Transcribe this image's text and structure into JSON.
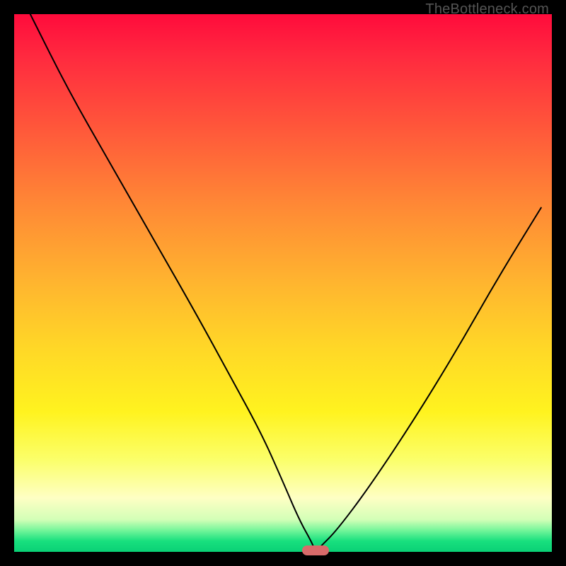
{
  "watermark": "TheBottleneck.com",
  "colors": {
    "gradient_top": "#ff0b3c",
    "gradient_mid1": "#ff8a35",
    "gradient_mid2": "#fff31f",
    "gradient_pale": "#feffc4",
    "gradient_bottom": "#0ad176",
    "curve": "#000000",
    "marker": "#d86a6a",
    "frame": "#000000"
  },
  "chart_data": {
    "type": "line",
    "title": "",
    "xlabel": "",
    "ylabel": "",
    "xlim": [
      0,
      100
    ],
    "ylim": [
      0,
      100
    ],
    "grid": false,
    "legend": false,
    "marker": {
      "x": 56,
      "y": 0,
      "width_pct": 5
    },
    "series": [
      {
        "name": "bottleneck-curve",
        "x": [
          3,
          10,
          18,
          26,
          34,
          40,
          46,
          50,
          53,
          55.5,
          56,
          57,
          60,
          66,
          74,
          82,
          90,
          98
        ],
        "y": [
          100,
          86,
          72,
          58,
          44,
          33,
          22,
          13,
          6,
          1.5,
          0,
          1,
          4,
          12,
          24,
          37,
          51,
          64
        ]
      }
    ],
    "annotations": [
      {
        "text": "TheBottleneck.com",
        "role": "watermark",
        "position": "top-right"
      }
    ]
  }
}
